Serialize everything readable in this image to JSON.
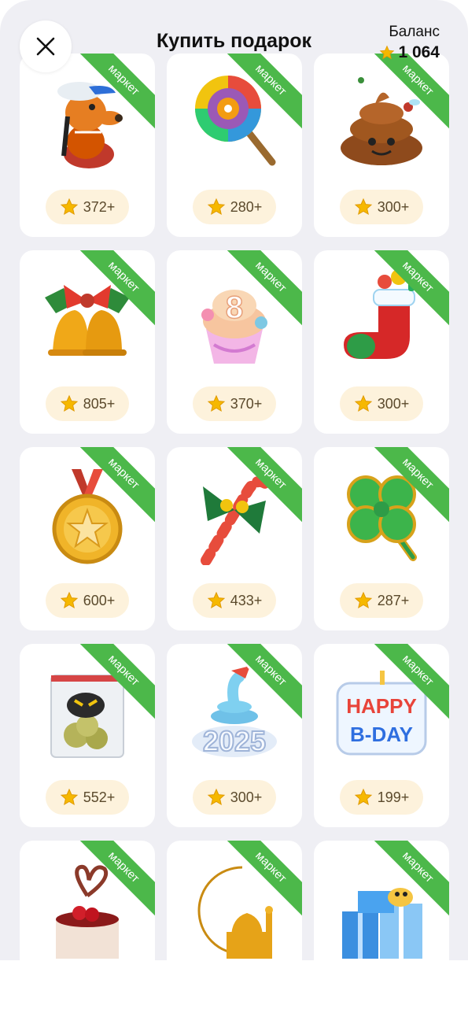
{
  "header": {
    "title": "Купить подарок",
    "balance_label": "Баланс",
    "balance_amount": "1 064"
  },
  "colors": {
    "ribbon": "#4cb84a",
    "price_pill": "#fdf2dc",
    "star": "#f6b800",
    "background": "#efeff4"
  },
  "gifts": [
    {
      "badge": "маркет",
      "price": "372+",
      "icon": "dog-with-cap-icon"
    },
    {
      "badge": "маркет",
      "price": "280+",
      "icon": "lollipop-icon"
    },
    {
      "badge": "маркет",
      "price": "300+",
      "icon": "poop-emoji-icon"
    },
    {
      "badge": "маркет",
      "price": "805+",
      "icon": "christmas-bells-icon"
    },
    {
      "badge": "маркет",
      "price": "370+",
      "icon": "cupcake-icon"
    },
    {
      "badge": "маркет",
      "price": "300+",
      "icon": "christmas-stocking-icon"
    },
    {
      "badge": "маркет",
      "price": "600+",
      "icon": "gold-medal-icon"
    },
    {
      "badge": "маркет",
      "price": "433+",
      "icon": "candy-cane-icon"
    },
    {
      "badge": "маркет",
      "price": "287+",
      "icon": "clover-icon"
    },
    {
      "badge": "маркет",
      "price": "552+",
      "icon": "bag-with-creature-icon"
    },
    {
      "badge": "маркет",
      "price": "300+",
      "icon": "snake-2025-icon"
    },
    {
      "badge": "маркет",
      "price": "199+",
      "icon": "happy-bday-icon"
    },
    {
      "badge": "маркет",
      "price": "",
      "icon": "cake-with-cherries-icon"
    },
    {
      "badge": "маркет",
      "price": "",
      "icon": "crescent-mosque-icon"
    },
    {
      "badge": "маркет",
      "price": "",
      "icon": "gift-boxes-snake-icon"
    }
  ]
}
